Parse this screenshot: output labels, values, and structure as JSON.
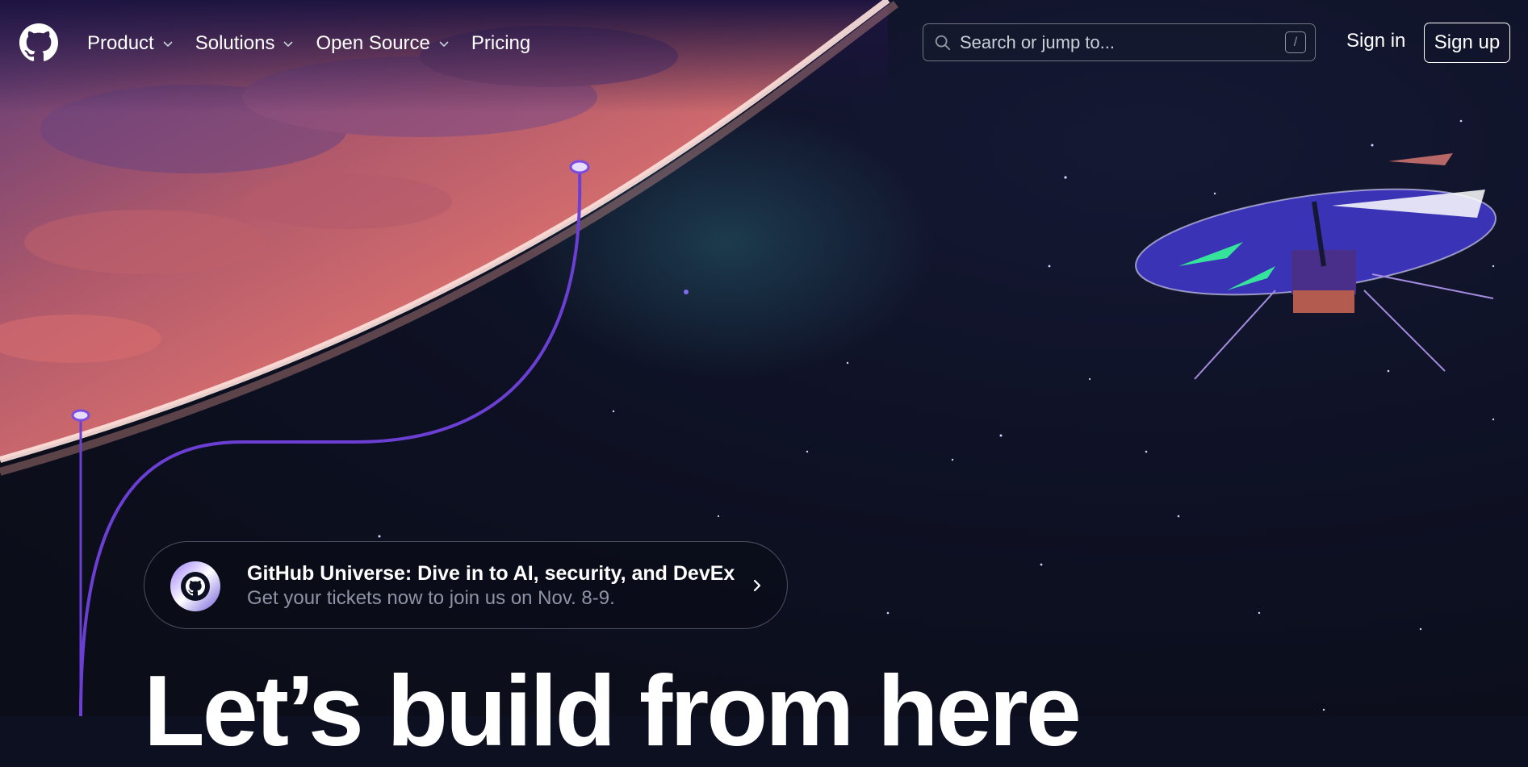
{
  "header": {
    "logo_icon": "github-mark-icon",
    "nav": [
      {
        "label": "Product",
        "has_dropdown": true
      },
      {
        "label": "Solutions",
        "has_dropdown": true
      },
      {
        "label": "Open Source",
        "has_dropdown": true
      },
      {
        "label": "Pricing",
        "has_dropdown": false
      }
    ],
    "search": {
      "placeholder": "Search or jump to...",
      "value": "",
      "shortcut": "/"
    },
    "sign_in": "Sign in",
    "sign_up": "Sign up"
  },
  "banner": {
    "title": "GitHub Universe: Dive in to AI, security, and DevEx",
    "subtitle": "Get your tickets now to join us on Nov. 8-9."
  },
  "hero": {
    "headline": "Let’s build from here"
  },
  "colors": {
    "background": "#0d1021",
    "planet_glow": "#f07a72",
    "accent_line": "#7c4ce0",
    "banner_subtitle": "#8e93a6"
  }
}
